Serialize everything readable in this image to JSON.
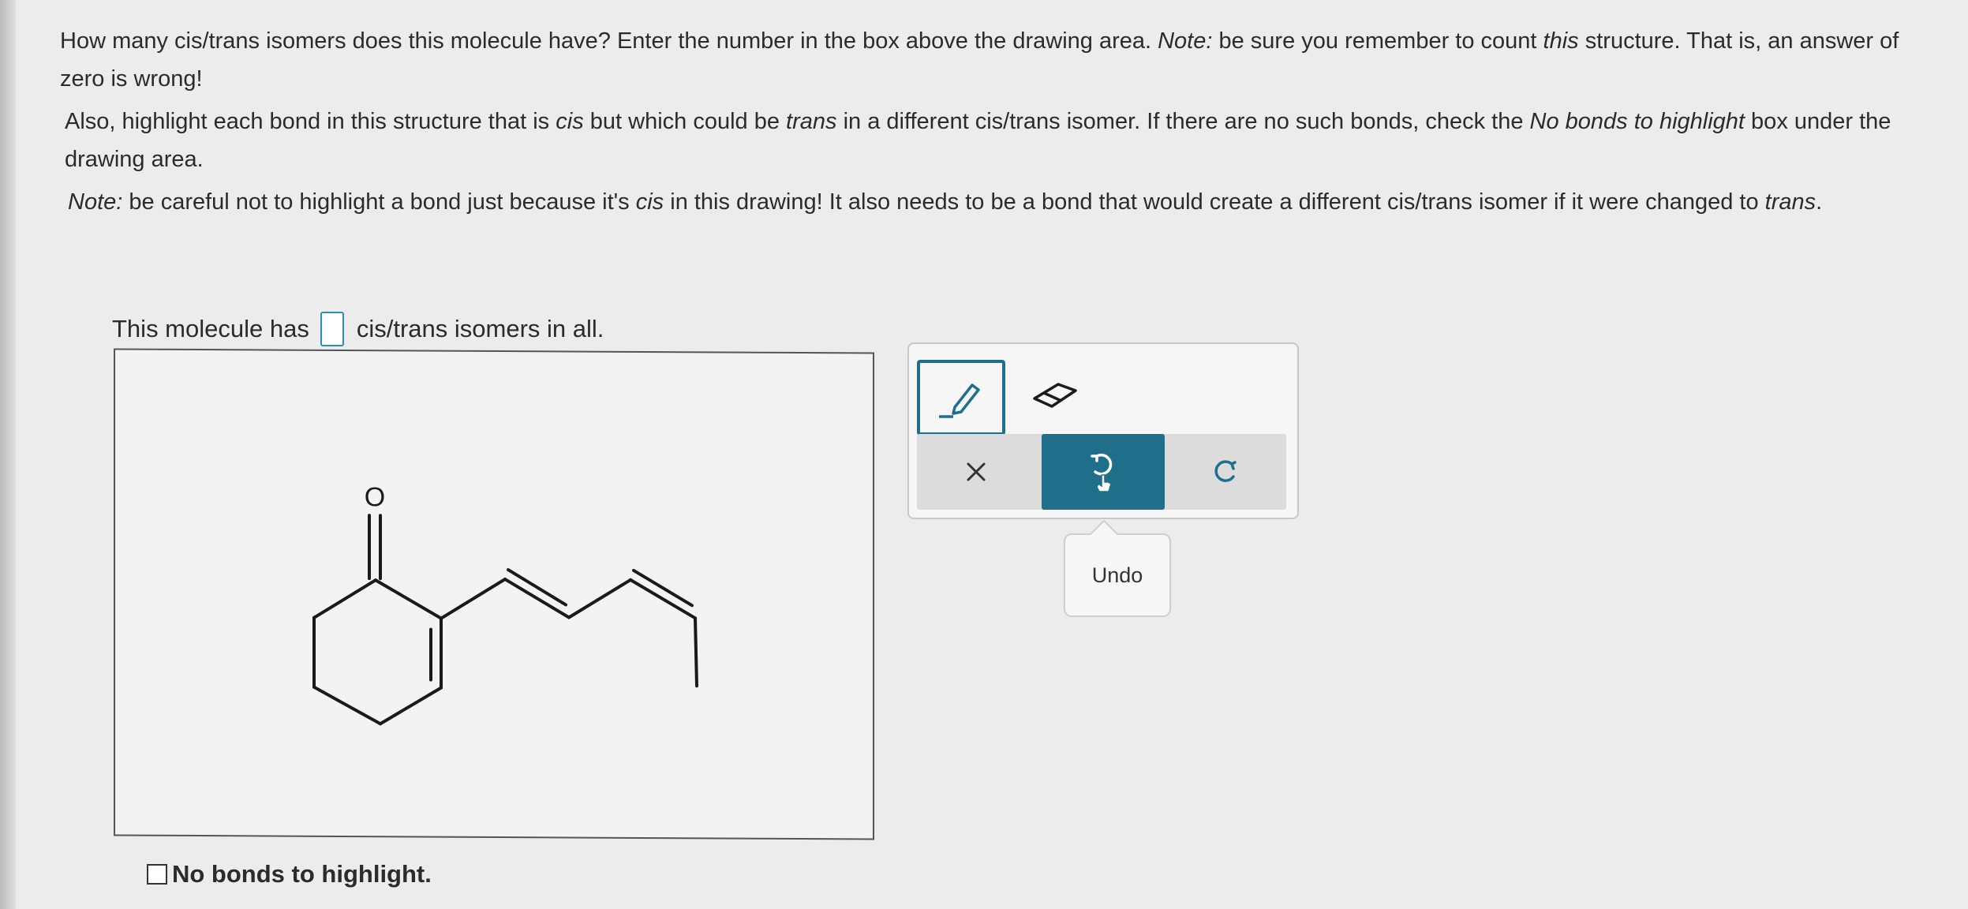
{
  "instructions": {
    "p1": {
      "a": "How many cis/trans isomers does this molecule have? Enter the number in the box above the drawing area. ",
      "note": "Note:",
      "b": " be sure you remember to count ",
      "this": "this",
      "c": " structure. That is, an answer of zero is wrong!"
    },
    "p2": {
      "a": "Also, highlight each bond in this structure that is ",
      "cis": "cis",
      "b": " but which could be ",
      "trans": "trans",
      "c": " in a different cis/trans isomer. If there are no such bonds, check the ",
      "nobonds": "No bonds to highlight",
      "d": " box under the drawing area."
    },
    "p3": {
      "note": "Note:",
      "a": " be careful not to highlight a bond just because it's ",
      "cis": "cis",
      "b": " in this drawing! It also needs to be a bond that would create a different cis/trans isomer if it were changed to ",
      "trans": "trans",
      "c": "."
    }
  },
  "answer": {
    "prefix": "This molecule has",
    "value": "",
    "suffix": "cis/trans isomers in all."
  },
  "molecule": {
    "oxygen_label": "O"
  },
  "toolbar": {
    "tools": [
      "pencil-icon",
      "eraser-icon"
    ],
    "actions": [
      "clear-icon",
      "undo-icon",
      "redo-icon"
    ],
    "undo_tooltip": "Undo",
    "accent": "#1f6f8b"
  },
  "no_bonds": {
    "label": "No bonds to highlight.",
    "checked": false
  }
}
